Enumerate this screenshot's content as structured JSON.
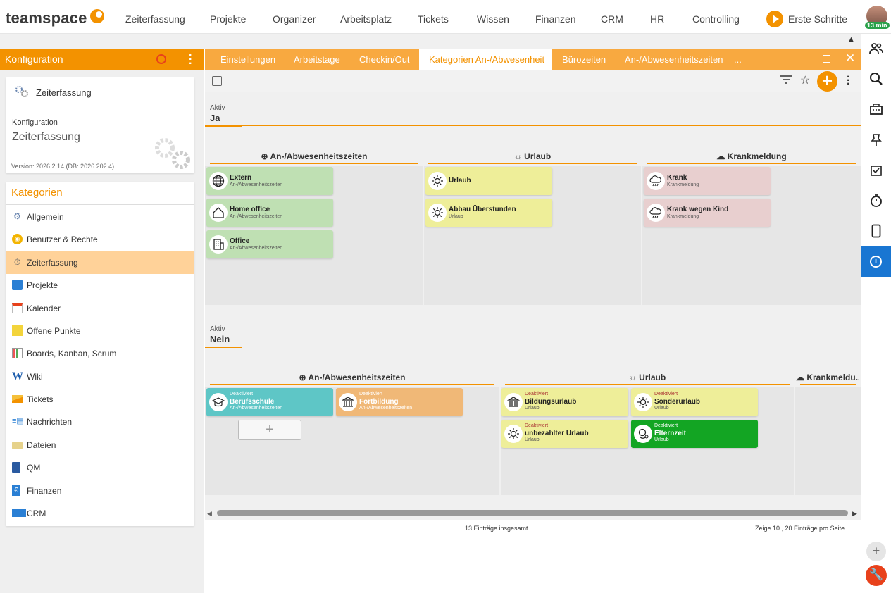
{
  "app": {
    "logo_text": "teamspace",
    "timer": "13 min"
  },
  "topnav": {
    "items": [
      "Zeiterfassung",
      "Projekte",
      "Organizer",
      "Arbeitsplatz",
      "Tickets",
      "Wissen",
      "Finanzen",
      "CRM",
      "HR",
      "Controlling"
    ],
    "first_steps": "Erste Schritte"
  },
  "sidebar": {
    "header_title": "Konfiguration",
    "module_card": {
      "name": "Zeiterfassung",
      "label": "Konfiguration",
      "value": "Zeiterfassung",
      "version": "Version: 2026.2.14 (DB: 2026.202.4)"
    },
    "categories_title": "Kategorien",
    "categories": [
      {
        "label": "Allgemein",
        "icon": "gears-icon"
      },
      {
        "label": "Benutzer & Rechte",
        "icon": "users-icon"
      },
      {
        "label": "Zeiterfassung",
        "icon": "stopwatch-icon",
        "active": true
      },
      {
        "label": "Projekte",
        "icon": "folder-icon"
      },
      {
        "label": "Kalender",
        "icon": "calendar-icon"
      },
      {
        "label": "Offene Punkte",
        "icon": "note-icon"
      },
      {
        "label": "Boards, Kanban, Scrum",
        "icon": "board-icon"
      },
      {
        "label": "Wiki",
        "icon": "wiki-icon"
      },
      {
        "label": "Tickets",
        "icon": "ticket-icon"
      },
      {
        "label": "Nachrichten",
        "icon": "messages-icon"
      },
      {
        "label": "Dateien",
        "icon": "files-icon"
      },
      {
        "label": "QM",
        "icon": "qm-icon"
      },
      {
        "label": "Finanzen",
        "icon": "euro-icon"
      },
      {
        "label": "CRM",
        "icon": "crm-icon"
      }
    ]
  },
  "tabs": {
    "items": [
      "Einstellungen",
      "Arbeitstage",
      "Checkin/Out",
      "Kategorien An-/Abwesenheit",
      "Bürozeiten",
      "An-/Abwesenheitszeiten",
      "..."
    ],
    "active": "Kategorien An-/Abwesenheit"
  },
  "board": {
    "group_label": "Aktiv",
    "groups": [
      {
        "value": "Ja",
        "columns": [
          {
            "title": "An-/Abwesenheitszeiten",
            "icon": "globe-icon"
          },
          {
            "title": "Urlaub",
            "icon": "sun-icon"
          },
          {
            "title": "Krankmeldung",
            "icon": "cloud-rain-icon"
          }
        ],
        "tiles": [
          {
            "name": "Extern",
            "sub": "An-/Abwesenheitszeiten",
            "icon": "globe-icon"
          },
          {
            "name": "Home office",
            "sub": "An-/Abwesenheitszeiten",
            "icon": "house-icon"
          },
          {
            "name": "Office",
            "sub": "An-/Abwesenheitszeiten",
            "icon": "building-icon"
          },
          {
            "name": "Urlaub",
            "sub": "",
            "icon": "sun-icon"
          },
          {
            "name": "Abbau Überstunden",
            "sub": "Urlaub",
            "icon": "sun-icon"
          },
          {
            "name": "Krank",
            "sub": "Krankmeldung",
            "icon": "cloud-rain-icon"
          },
          {
            "name": "Krank wegen Kind",
            "sub": "Krankmeldung",
            "icon": "cloud-rain-icon"
          }
        ]
      },
      {
        "value": "Nein",
        "columns": [
          {
            "title": "An-/Abwesenheitszeiten",
            "icon": "globe-icon"
          },
          {
            "title": "Urlaub",
            "icon": "sun-icon"
          },
          {
            "title": "Krankmeldu...",
            "icon": "cloud-rain-icon"
          }
        ],
        "deactivated_label": "Deaktiviert",
        "tiles": [
          {
            "name": "Berufsschule",
            "sub": "An-/Abwesenheitszeiten",
            "icon": "graduation-cap-icon"
          },
          {
            "name": "Fortbildung",
            "sub": "An-/Abwesenheitszeiten",
            "icon": "institution-icon"
          },
          {
            "name": "Bildungsurlaub",
            "sub": "Urlaub",
            "icon": "institution-icon"
          },
          {
            "name": "Sonderurlaub",
            "sub": "Urlaub",
            "icon": "sun-icon"
          },
          {
            "name": "unbezahlter Urlaub",
            "sub": "Urlaub",
            "icon": "sun-icon"
          },
          {
            "name": "Elternzeit",
            "sub": "Urlaub",
            "icon": "baby-icon"
          }
        ],
        "add_label": "+"
      }
    ]
  },
  "footer": {
    "total": "13 Einträge insgesamt",
    "per_page": "Zeige  10 ,  20  Einträge pro Seite"
  },
  "colors": {
    "accent": "#f39200",
    "active_blue": "#1976d2"
  }
}
